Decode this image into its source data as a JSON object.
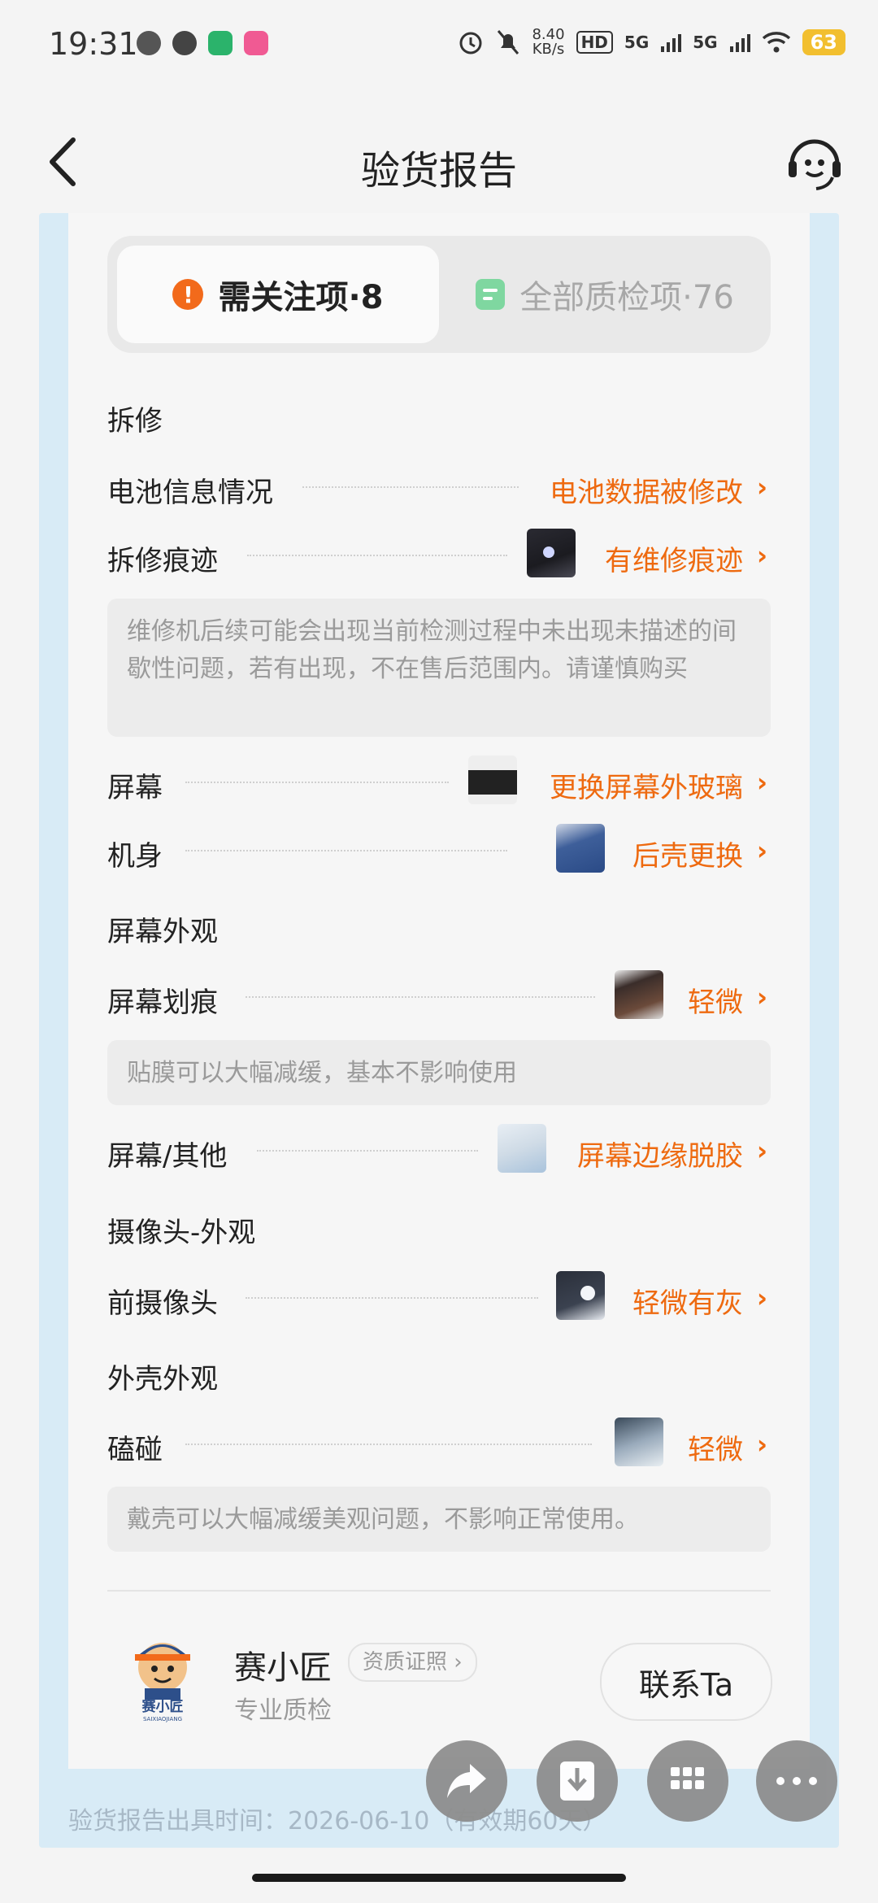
{
  "status_bar": {
    "time": "19:31",
    "speed_top": "8.40",
    "speed_bottom": "KB/s",
    "hd": "HD",
    "net1": "5G",
    "net2": "5G",
    "battery": "63"
  },
  "header": {
    "title": "验货报告"
  },
  "tabs": [
    {
      "label": "需关注项·8",
      "active": true
    },
    {
      "label": "全部质检项·76",
      "active": false
    }
  ],
  "sections": {
    "s1": {
      "title": "拆修",
      "rows": [
        {
          "label": "电池信息情况",
          "value": "电池数据被修改"
        },
        {
          "label": "拆修痕迹",
          "value": "有维修痕迹"
        }
      ],
      "note": "维修机后续可能会出现当前检测过程中未出现未描述的间歇性问题，若有出现，不在售后范围内。请谨慎购买",
      "rows2": [
        {
          "label": "屏幕",
          "value": "更换屏幕外玻璃"
        },
        {
          "label": "机身",
          "value": "后壳更换"
        }
      ]
    },
    "s2": {
      "title": "屏幕外观",
      "rows": [
        {
          "label": "屏幕划痕",
          "value": "轻微"
        }
      ],
      "note": "贴膜可以大幅减缓，基本不影响使用",
      "rows2": [
        {
          "label": "屏幕/其他",
          "value": "屏幕边缘脱胶"
        }
      ]
    },
    "s3": {
      "title": "摄像头-外观",
      "rows": [
        {
          "label": "前摄像头",
          "value": "轻微有灰"
        }
      ]
    },
    "s4": {
      "title": "外壳外观",
      "rows": [
        {
          "label": "磕碰",
          "value": "轻微"
        }
      ],
      "note": "戴壳可以大幅减缓美观问题，不影响正常使用。"
    }
  },
  "inspector": {
    "name": "赛小匠",
    "badge": "资质证照",
    "subtitle": "专业质检",
    "logo_text": "赛小匠",
    "logo_sub": "SAIXIAOJIANG",
    "contact_label": "联系Ta"
  },
  "footer": {
    "issued": "验货报告出具时间：2026-06-10（有效期60天）"
  },
  "colors": {
    "accent": "#ee6a10",
    "frame_blue": "#d8ebf6",
    "warn": "#f26a1b",
    "check_green": "#7fd7a0"
  }
}
